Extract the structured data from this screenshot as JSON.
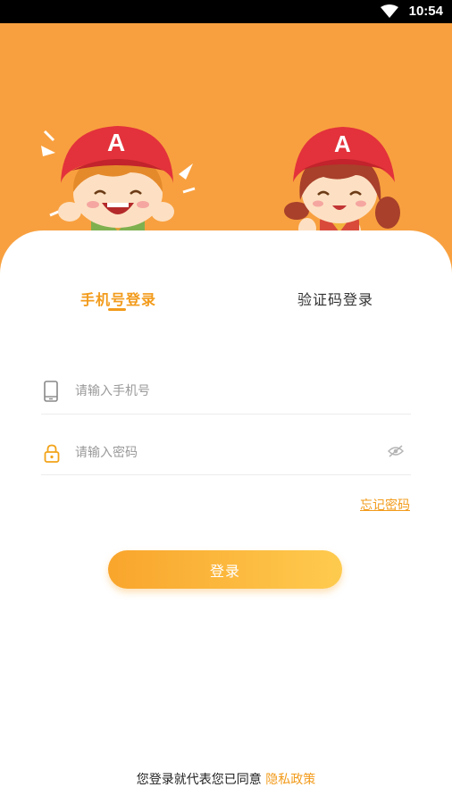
{
  "status_bar": {
    "time": "10:54",
    "wifi_icon": "wifi-icon"
  },
  "tabs": [
    {
      "label": "手机号登录",
      "active": true
    },
    {
      "label": "验证码登录",
      "active": false
    }
  ],
  "form": {
    "phone": {
      "placeholder": "请输入手机号",
      "value": "",
      "icon": "phone-icon"
    },
    "password": {
      "placeholder": "请输入密码",
      "value": "",
      "icon": "lock-icon",
      "toggle_icon": "eye-hidden-icon"
    },
    "forgot_label": "忘记密码",
    "login_label": "登录"
  },
  "agreement": {
    "prefix": "您登录就代表您已同意",
    "link": "隐私政策"
  },
  "colors": {
    "accent": "#f29b1b",
    "hero_bg": "#f8a03f",
    "button_start": "#f9a52c",
    "button_end": "#fecb4f"
  }
}
